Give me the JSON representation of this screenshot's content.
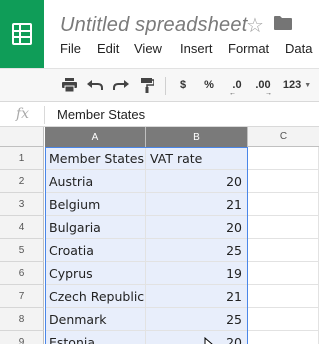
{
  "app": {
    "title": "Untitled spreadsheet",
    "icon": "sheets-app-icon"
  },
  "menu": [
    "File",
    "Edit",
    "View",
    "Insert",
    "Format",
    "Data"
  ],
  "toolbar": {
    "currency": "$",
    "percent": "%",
    "decrease_decimals": ".0",
    "increase_decimals": ".00",
    "more_formats": "123"
  },
  "formula_bar": {
    "fx": "fx",
    "value": "Member States"
  },
  "columns": [
    {
      "label": "A",
      "selected": true
    },
    {
      "label": "B",
      "selected": true
    },
    {
      "label": "C",
      "selected": false
    }
  ],
  "rows": [
    {
      "num": "1",
      "a": "Member States",
      "b": "VAT rate"
    },
    {
      "num": "2",
      "a": "Austria",
      "b": "20"
    },
    {
      "num": "3",
      "a": "Belgium",
      "b": "21"
    },
    {
      "num": "4",
      "a": "Bulgaria",
      "b": "20"
    },
    {
      "num": "5",
      "a": "Croatia",
      "b": "25"
    },
    {
      "num": "6",
      "a": "Cyprus",
      "b": "19"
    },
    {
      "num": "7",
      "a": "Czech Republic",
      "b": "21"
    },
    {
      "num": "8",
      "a": "Denmark",
      "b": "25"
    },
    {
      "num": "9",
      "a": "Estonia",
      "b": "20"
    }
  ],
  "colors": {
    "brand": "#0f9d58",
    "selection": "#4a86e8",
    "selected_fill": "#e8eefb",
    "selected_header": "#7a7a7a"
  }
}
